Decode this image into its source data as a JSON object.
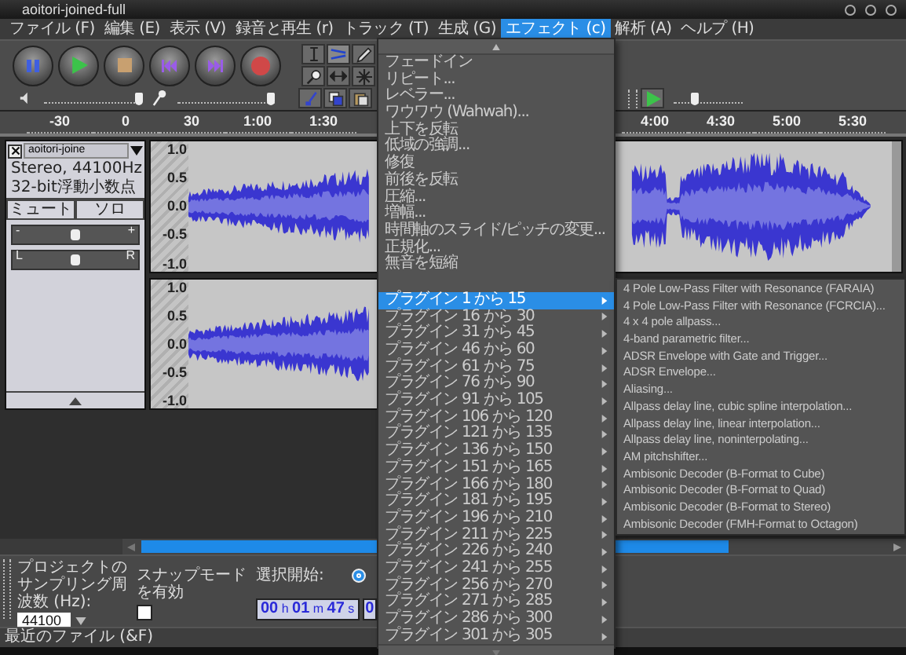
{
  "window": {
    "title": "aoitori-joined-full"
  },
  "menu_bar": [
    {
      "label": "ファイル (F)",
      "selected": false
    },
    {
      "label": "編集 (E)",
      "selected": false
    },
    {
      "label": "表示 (V)",
      "selected": false
    },
    {
      "label": "録音と再生 (r)",
      "selected": false
    },
    {
      "label": "トラック (T)",
      "selected": false
    },
    {
      "label": "生成 (G)",
      "selected": false
    },
    {
      "label": "エフェクト (c)",
      "selected": true
    },
    {
      "label": "解析 (A)",
      "selected": false
    },
    {
      "label": "ヘルプ (H)",
      "selected": false
    }
  ],
  "toolbar": {
    "playback_volume": {
      "level": 0.97
    },
    "recording_volume": {
      "level": 0.95
    },
    "play_speed": {
      "level": 0.3
    }
  },
  "ruler": {
    "start_labels": [
      "-30",
      "0",
      "30",
      "1:00",
      "1:30"
    ],
    "end_labels": [
      "4:00",
      "4:30",
      "5:00",
      "5:30"
    ]
  },
  "track": {
    "name": "aoitori-joine",
    "info": [
      "Stereo, 44100Hz",
      "32-bit浮動小数点"
    ],
    "mute_label": "ミュート",
    "solo_label": "ソロ",
    "gain": {
      "min_label": "-",
      "max_label": "+",
      "level": 0.5
    },
    "pan": {
      "left_label": "L",
      "right_label": "R",
      "level": 0.5
    },
    "channels": [
      {
        "scale": [
          "1.0",
          "0.5",
          "0.0",
          "-0.5",
          "-1.0"
        ]
      },
      {
        "scale": [
          "1.0",
          "0.5",
          "0.0",
          "-0.5",
          "-1.0"
        ]
      }
    ]
  },
  "effects_menu": {
    "effects": [
      {
        "label": "フェードイン",
        "selected": false
      },
      {
        "label": "リピート...",
        "selected": false
      },
      {
        "label": "レベラー...",
        "selected": false
      },
      {
        "label": "ワウワウ (Wahwah)...",
        "selected": false
      },
      {
        "label": "上下を反転",
        "selected": false
      },
      {
        "label": "低域の強調...",
        "selected": false
      },
      {
        "label": "修復",
        "selected": false
      },
      {
        "label": "前後を反転",
        "selected": false
      },
      {
        "label": "圧縮...",
        "selected": false
      },
      {
        "label": "増幅...",
        "selected": false
      },
      {
        "label": "時間軸のスライド/ピッチの変更...",
        "selected": false
      },
      {
        "label": "正規化...",
        "selected": false
      },
      {
        "label": "無音を短縮",
        "selected": false
      }
    ],
    "plugin_groups": [
      {
        "label": "プラグイン 1 から 15",
        "selected": true
      },
      {
        "label": "プラグイン 16 から 30",
        "selected": false
      },
      {
        "label": "プラグイン 31 から 45",
        "selected": false
      },
      {
        "label": "プラグイン 46 から 60",
        "selected": false
      },
      {
        "label": "プラグイン 61 から 75",
        "selected": false
      },
      {
        "label": "プラグイン 76 から 90",
        "selected": false
      },
      {
        "label": "プラグイン 91 から 105",
        "selected": false
      },
      {
        "label": "プラグイン 106 から 120",
        "selected": false
      },
      {
        "label": "プラグイン 121 から 135",
        "selected": false
      },
      {
        "label": "プラグイン 136 から 150",
        "selected": false
      },
      {
        "label": "プラグイン 151 から 165",
        "selected": false
      },
      {
        "label": "プラグイン 166 から 180",
        "selected": false
      },
      {
        "label": "プラグイン 181 から 195",
        "selected": false
      },
      {
        "label": "プラグイン 196 から 210",
        "selected": false
      },
      {
        "label": "プラグイン 211 から 225",
        "selected": false
      },
      {
        "label": "プラグイン 226 から 240",
        "selected": false
      },
      {
        "label": "プラグイン 241 から 255",
        "selected": false
      },
      {
        "label": "プラグイン 256 から 270",
        "selected": false
      },
      {
        "label": "プラグイン 271 から 285",
        "selected": false
      },
      {
        "label": "プラグイン 286 から 300",
        "selected": false
      },
      {
        "label": "プラグイン 301 から 305",
        "selected": false
      }
    ]
  },
  "plugin_submenu": [
    {
      "label": "4 Pole Low-Pass Filter with Resonance (FARAIA)",
      "selected": false
    },
    {
      "label": "4 Pole Low-Pass Filter with Resonance (FCRCIA)...",
      "selected": false
    },
    {
      "label": "4 x 4 pole allpass...",
      "selected": false
    },
    {
      "label": "4-band parametric filter...",
      "selected": false
    },
    {
      "label": "ADSR Envelope with Gate and Trigger...",
      "selected": false
    },
    {
      "label": "ADSR Envelope...",
      "selected": false
    },
    {
      "label": "Aliasing...",
      "selected": false
    },
    {
      "label": "Allpass delay line, cubic spline interpolation...",
      "selected": false
    },
    {
      "label": "Allpass delay line, linear interpolation...",
      "selected": false
    },
    {
      "label": "Allpass delay line, noninterpolating...",
      "selected": false
    },
    {
      "label": "AM pitchshifter...",
      "selected": false
    },
    {
      "label": "Ambisonic Decoder (B-Format to Cube)",
      "selected": false
    },
    {
      "label": "Ambisonic Decoder (B-Format to Quad)",
      "selected": false
    },
    {
      "label": "Ambisonic Decoder (B-Format to Stereo)",
      "selected": false
    },
    {
      "label": "Ambisonic Decoder (FMH-Format to Octagon)",
      "selected": false
    }
  ],
  "selection_bar": {
    "rate_label": "プロジェクトのサンプリング周波数 (Hz):",
    "rate_value": "44100",
    "snap_label": "スナップモードを有効",
    "snap_checked": false,
    "start_label": "選択開始:",
    "start_radio_selected": true,
    "start_time": "**00** h **01** m **47** s",
    "second_time": "0"
  },
  "status_bar": {
    "text": "最近のファイル (&F)"
  }
}
